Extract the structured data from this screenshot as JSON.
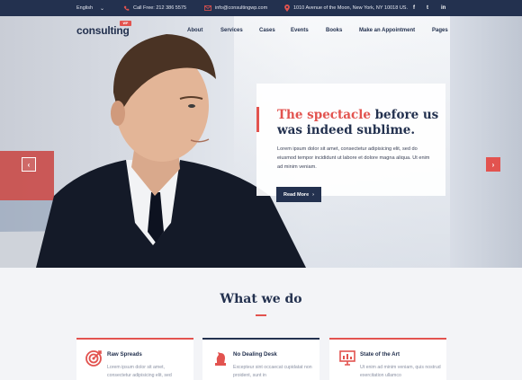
{
  "topbar": {
    "language": "English",
    "phone": "Call Free: 212 386 5575",
    "email": "info@consultingwp.com",
    "address": "1010 Avenue of the Moon, New York, NY 10018 US.",
    "social": {
      "facebook": "f",
      "twitter": "t",
      "linkedin": "in"
    }
  },
  "header": {
    "logo": "consulting",
    "logo_badge": "WP",
    "nav": [
      "About",
      "Services",
      "Cases",
      "Events",
      "Books",
      "Make an Appointment",
      "Pages"
    ]
  },
  "hero": {
    "title_highlight": "The spectacle",
    "title_rest": " before us was indeed sublime.",
    "body": "Lorem ipsum dolor sit amet, consectetur adipisicing elit, sed do eiusmod tempor incididunt ut labore et dolore magna aliqua. Ut enim ad minim veniam.",
    "button": "Read More",
    "button_icon": "›",
    "prev": "‹",
    "next": "›"
  },
  "section": {
    "title": "What we do",
    "features": [
      {
        "title": "Raw Spreads",
        "text": "Lorem ipsum dolor sit amet, consectetur adipisicing elit, sed"
      },
      {
        "title": "No Dealing Desk",
        "text": "Excepteur sint occaecat cupidatat non proident, sunt in"
      },
      {
        "title": "State of the Art",
        "text": "Ut enim ad minim veniam, quis nostrud exercitation ullamco"
      }
    ]
  },
  "colors": {
    "navy": "#23314f",
    "accent": "#e2534f"
  }
}
